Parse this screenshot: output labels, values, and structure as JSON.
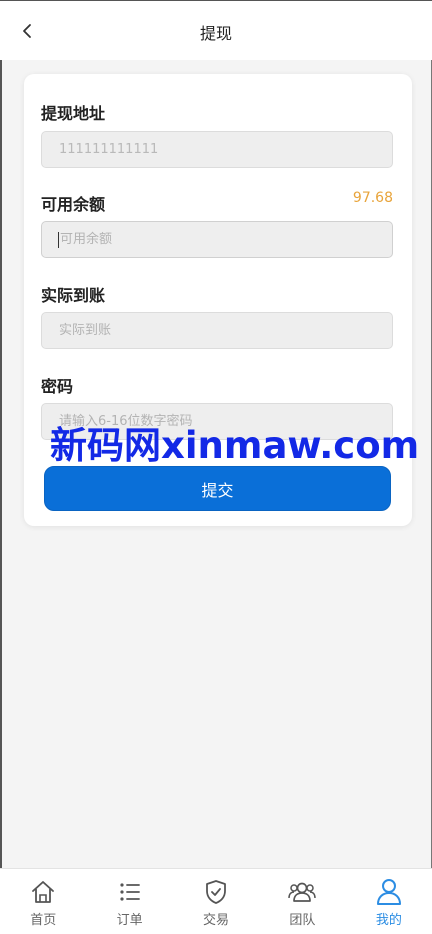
{
  "header": {
    "title": "提现",
    "back_icon": "chevron-left-icon"
  },
  "form": {
    "address": {
      "label": "提现地址",
      "value": "111111111111"
    },
    "available": {
      "label": "可用余额",
      "balance": "97.68",
      "placeholder": "可用余额"
    },
    "actual": {
      "label": "实际到账",
      "placeholder": "实际到账"
    },
    "password": {
      "label": "密码",
      "placeholder": "请输入6-16位数字密码"
    },
    "submit_label": "提交"
  },
  "watermark": "新码网xinmaw.com",
  "tabbar": {
    "items": [
      {
        "label": "首页",
        "icon": "home-icon"
      },
      {
        "label": "订单",
        "icon": "list-icon"
      },
      {
        "label": "交易",
        "icon": "shield-check-icon"
      },
      {
        "label": "团队",
        "icon": "team-icon"
      },
      {
        "label": "我的",
        "icon": "user-icon",
        "active": true
      }
    ],
    "active_color": "#2c8de3"
  },
  "colors": {
    "primary": "#0a6fd8",
    "balance": "#e8a43b",
    "watermark": "#1329e6"
  }
}
